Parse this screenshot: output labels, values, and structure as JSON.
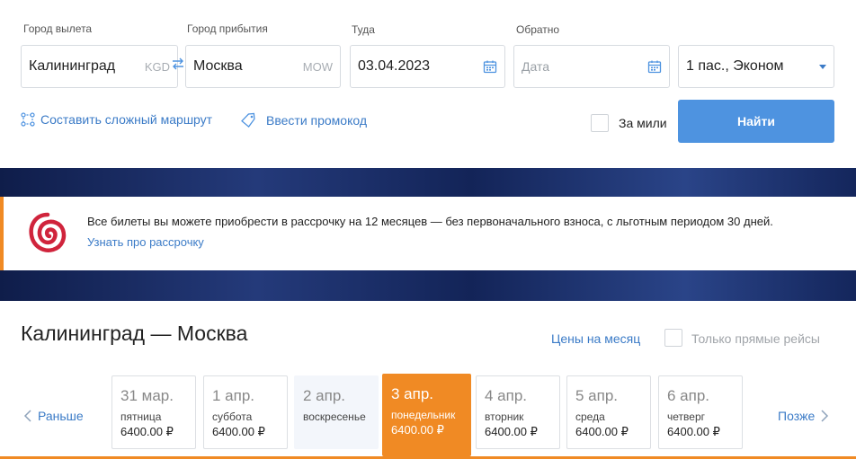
{
  "search": {
    "from_label": "Город вылета",
    "from_value": "Калининград",
    "from_code": "KGD",
    "to_label": "Город прибытия",
    "to_value": "Москва",
    "to_code": "MOW",
    "depart_label": "Туда",
    "depart_value": "03.04.2023",
    "return_label": "Обратно",
    "return_placeholder": "Дата",
    "passengers_value": "1 пас., Эконом",
    "complex_route_link": "Составить сложный маршрут",
    "promo_code_link": "Ввести промокод",
    "miles_label": "За мили",
    "find_button": "Найти"
  },
  "promo": {
    "text": "Все билеты вы можете приобрести в рассрочку на 12 месяцев — без первоначального взноса, с льготным периодом 30 дней.",
    "link": "Узнать про рассрочку"
  },
  "results": {
    "route_title": "Калининград — Москва",
    "month_prices_link": "Цены на месяц",
    "direct_only_label": "Только прямые рейсы",
    "earlier_link": "Раньше",
    "later_link": "Позже",
    "days": [
      {
        "date": "31 мар.",
        "weekday": "пятница",
        "price": "6400.00 ₽"
      },
      {
        "date": "1 апр.",
        "weekday": "суббота",
        "price": "6400.00 ₽"
      },
      {
        "date": "2 апр.",
        "weekday": "воскресенье",
        "price": ""
      },
      {
        "date": "3 апр.",
        "weekday": "понедельник",
        "price": "6400.00 ₽"
      },
      {
        "date": "4 апр.",
        "weekday": "вторник",
        "price": "6400.00 ₽"
      },
      {
        "date": "5 апр.",
        "weekday": "среда",
        "price": "6400.00 ₽"
      },
      {
        "date": "6 апр.",
        "weekday": "четверг",
        "price": "6400.00 ₽"
      }
    ]
  },
  "colors": {
    "accent": "#4e93e0",
    "link": "#3b7bc7",
    "active_day": "#f08a24"
  }
}
